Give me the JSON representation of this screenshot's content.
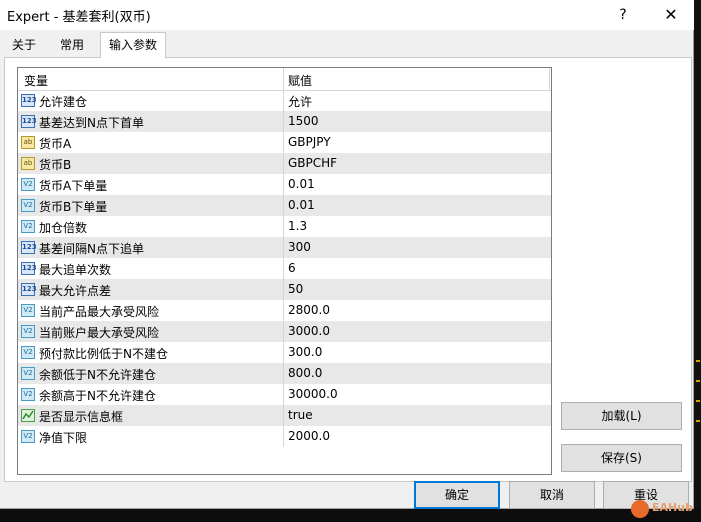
{
  "window": {
    "title": "Expert - 基差套利(双币)",
    "help_label": "?",
    "close_label": "✕"
  },
  "tabs": [
    {
      "label": "关于",
      "active": false
    },
    {
      "label": "常用",
      "active": false
    },
    {
      "label": "输入参数",
      "active": true
    }
  ],
  "grid": {
    "header_variable": "变量",
    "header_value": "赋值",
    "rows": [
      {
        "icon": "int",
        "icon_text": "123",
        "name": "允许建仓",
        "value": "允许"
      },
      {
        "icon": "int",
        "icon_text": "123",
        "name": "基差达到N点下首单",
        "value": "1500"
      },
      {
        "icon": "str",
        "icon_text": "ab",
        "name": "货币A",
        "value": "GBPJPY"
      },
      {
        "icon": "str",
        "icon_text": "ab",
        "name": "货币B",
        "value": "GBPCHF"
      },
      {
        "icon": "dbl",
        "icon_text": "V2",
        "name": "货币A下单量",
        "value": "0.01"
      },
      {
        "icon": "dbl",
        "icon_text": "V2",
        "name": "货币B下单量",
        "value": "0.01"
      },
      {
        "icon": "dbl",
        "icon_text": "V2",
        "name": "加仓倍数",
        "value": "1.3"
      },
      {
        "icon": "int",
        "icon_text": "123",
        "name": "基差间隔N点下追单",
        "value": "300"
      },
      {
        "icon": "int",
        "icon_text": "123",
        "name": "最大追单次数",
        "value": "6"
      },
      {
        "icon": "int",
        "icon_text": "123",
        "name": "最大允许点差",
        "value": "50"
      },
      {
        "icon": "dbl",
        "icon_text": "V2",
        "name": "当前产品最大承受风险",
        "value": "2800.0"
      },
      {
        "icon": "dbl",
        "icon_text": "V2",
        "name": "当前账户最大承受风险",
        "value": "3000.0"
      },
      {
        "icon": "dbl",
        "icon_text": "V2",
        "name": "预付款比例低于N不建仓",
        "value": "300.0"
      },
      {
        "icon": "dbl",
        "icon_text": "V2",
        "name": "余额低于N不允许建仓",
        "value": "800.0"
      },
      {
        "icon": "dbl",
        "icon_text": "V2",
        "name": "余额高于N不允许建仓",
        "value": "30000.0"
      },
      {
        "icon": "bool",
        "icon_text": "",
        "name": "是否显示信息框",
        "value": "true"
      },
      {
        "icon": "dbl",
        "icon_text": "V2",
        "name": "净值下限",
        "value": "2000.0"
      }
    ]
  },
  "buttons": {
    "load": "加载(L)",
    "save": "保存(S)",
    "ok": "确定",
    "cancel": "取消",
    "reset": "重设"
  },
  "watermark": "EAHub"
}
